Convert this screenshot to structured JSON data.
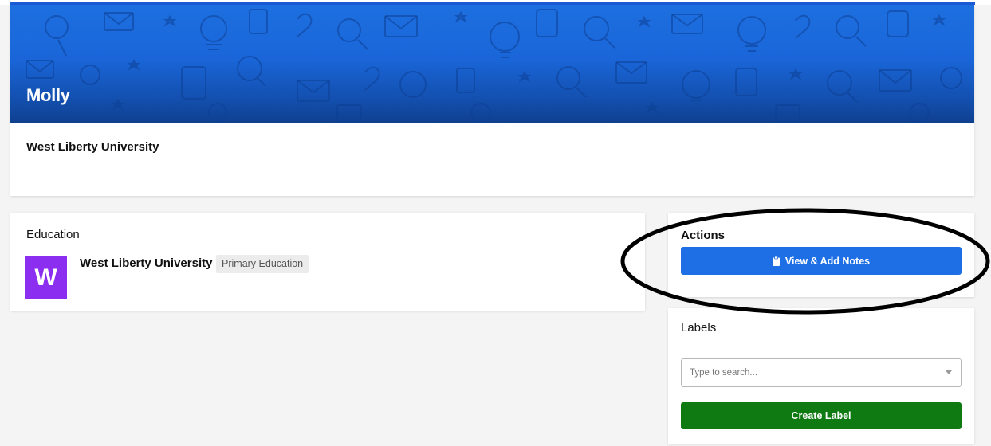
{
  "profile": {
    "name": "Molly",
    "school": "West Liberty University"
  },
  "education": {
    "title": "Education",
    "entries": [
      {
        "logo_letter": "W",
        "school": "West Liberty University",
        "program": "Primary Education"
      }
    ]
  },
  "actions": {
    "title": "Actions",
    "notes_button": "View & Add Notes",
    "notes_icon": "clipboard-icon"
  },
  "labels": {
    "title": "Labels",
    "search_placeholder": "Type to search...",
    "create_button": "Create Label"
  },
  "colors": {
    "banner": "#1a66d9",
    "primary_button": "#1e6fe6",
    "create_button": "#0f7a12",
    "logo": "#8b2ef0"
  }
}
